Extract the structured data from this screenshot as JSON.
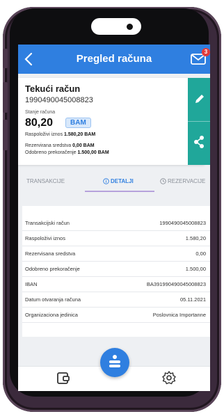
{
  "header": {
    "title": "Pregled računa",
    "notification_count": "3"
  },
  "account": {
    "name": "Tekući račun",
    "number": "1990490045008823",
    "balance_label": "Stanje računa",
    "balance": "80,20",
    "currency": "BAM",
    "available_label": "Raspoloživi iznos",
    "available": "1.580,20 BAM",
    "reserved_label": "Rezervirana sredstva",
    "reserved": "0,00 BAM",
    "overdraft_label": "Odobreno prekoračenje",
    "overdraft": "1.500,00 BAM"
  },
  "tabs": [
    {
      "label": "TRANSAKCIJE",
      "active": false
    },
    {
      "label": "DETALJI",
      "active": true
    },
    {
      "label": "REZERVACIJE",
      "active": false
    }
  ],
  "details": [
    {
      "label": "Transakcijski račun",
      "value": "1990490045008823"
    },
    {
      "label": "Raspoloživi iznos",
      "value": "1.580,20"
    },
    {
      "label": "Rezervisana sredstva",
      "value": "0,00"
    },
    {
      "label": "Odobreno prekoračenje",
      "value": "1.500,00"
    },
    {
      "label": "IBAN",
      "value": "BA391990490045008823"
    },
    {
      "label": "Datum otvaranja računa",
      "value": "05.11.2021"
    },
    {
      "label": "Organizaciona jedinica",
      "value": "Poslovnica Importanne"
    }
  ],
  "colors": {
    "primary": "#2f7fe0",
    "action_panel": "#20a79a",
    "tab_underline": "#b6a2dc",
    "badge": "#e33b3b"
  },
  "icons": {
    "back": "chevron-left-icon",
    "mail": "mail-icon",
    "edit": "pencil-icon",
    "share": "share-icon",
    "wallet": "wallet-icon",
    "home": "bank-s-icon",
    "settings": "gear-icon"
  }
}
